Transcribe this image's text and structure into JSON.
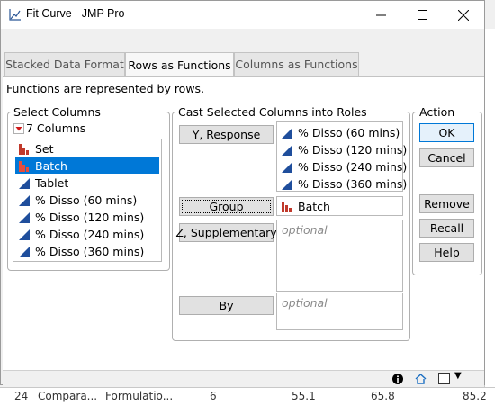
{
  "window": {
    "title": "Fit Curve - JMP Pro",
    "minimize": "–",
    "maximize": "☐",
    "close": "✕"
  },
  "tabs": [
    {
      "label": "Stacked Data Format"
    },
    {
      "label": "Rows as Functions"
    },
    {
      "label": "Columns as Functions"
    }
  ],
  "description": "Functions are represented by rows.",
  "select_columns": {
    "title": "Select Columns",
    "count_label": "7 Columns",
    "items": [
      {
        "label": "Set",
        "icon": "nominal-bar-icon"
      },
      {
        "label": "Batch",
        "icon": "nominal-bar-icon",
        "selected": true
      },
      {
        "label": "Tablet",
        "icon": "continuous-triangle-icon"
      },
      {
        "label": "% Disso (60 mins)",
        "icon": "continuous-triangle-icon"
      },
      {
        "label": "% Disso (120 mins)",
        "icon": "continuous-triangle-icon"
      },
      {
        "label": "% Disso (240 mins)",
        "icon": "continuous-triangle-icon"
      },
      {
        "label": "% Disso (360 mins)",
        "icon": "continuous-triangle-icon"
      }
    ]
  },
  "roles": {
    "title": "Cast Selected Columns into Roles",
    "y_response": {
      "label": "Y, Response",
      "values": [
        "% Disso (60 mins)",
        "% Disso (120 mins)",
        "% Disso (240 mins)",
        "% Disso (360 mins)"
      ]
    },
    "group": {
      "label": "Group",
      "value": "Batch"
    },
    "z_supplementary": {
      "label": "Z, Supplementary",
      "placeholder": "optional"
    },
    "by": {
      "label": "By",
      "placeholder": "optional"
    }
  },
  "action": {
    "title": "Action",
    "ok": "OK",
    "cancel": "Cancel",
    "remove": "Remove",
    "recall": "Recall",
    "help": "Help"
  },
  "status_bar": {
    "info_icon": "info-icon",
    "home_icon": "home-icon",
    "checkbox_icon": "checkbox-icon",
    "dropdown": "▼"
  },
  "background_row": {
    "row": "24",
    "c1": "Compara...",
    "c2": "Formulatio...",
    "c3": "6",
    "c4": "55.1",
    "c5": "65.8",
    "c6": "85.2"
  },
  "colors": {
    "accent": "#0078d7",
    "nominal": "#c0392b",
    "continuous": "#1f4e9c"
  }
}
